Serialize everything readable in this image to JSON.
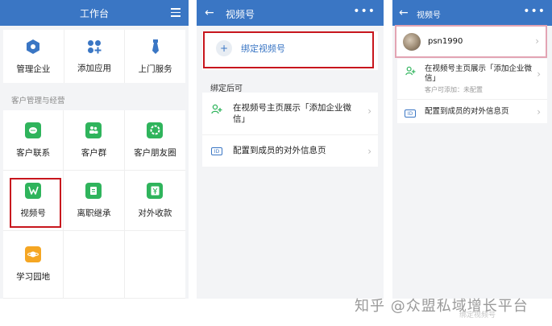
{
  "panel1": {
    "title": "工作台",
    "top_items": [
      {
        "label": "管理企业",
        "icon": "hexagon-icon"
      },
      {
        "label": "添加应用",
        "icon": "apps-plus-icon"
      },
      {
        "label": "上门服务",
        "icon": "tie-icon"
      }
    ],
    "section_title": "客户管理与经营",
    "apps": [
      {
        "label": "客户联系",
        "icon": "chat-icon"
      },
      {
        "label": "客户群",
        "icon": "group-icon"
      },
      {
        "label": "客户朋友圈",
        "icon": "moments-icon"
      },
      {
        "label": "视频号",
        "icon": "channels-icon"
      },
      {
        "label": "离职继承",
        "icon": "handover-icon"
      },
      {
        "label": "对外收款",
        "icon": "payment-icon"
      },
      {
        "label": "学习园地",
        "icon": "planet-icon"
      }
    ]
  },
  "panel2": {
    "title": "视频号",
    "bind_label": "绑定视频号",
    "after_title": "绑定后可",
    "row1_text": "在视频号主页展示「添加企业微信」",
    "row2_text": "配置到成员的对外信息页"
  },
  "panel3": {
    "title": "视频号",
    "username": "psn1990",
    "row1_text": "在视频号主页展示「添加企业微信」",
    "row1_sub": "客户可添加：未配置",
    "row2_text": "配置到成员的对外信息页"
  },
  "watermark": "知乎 @众盟私域增长平台",
  "watermark_faint": "绑定视频号",
  "colors": {
    "brand_blue": "#3a76c4",
    "green": "#2fb45c",
    "highlight_red": "#c8161d"
  }
}
